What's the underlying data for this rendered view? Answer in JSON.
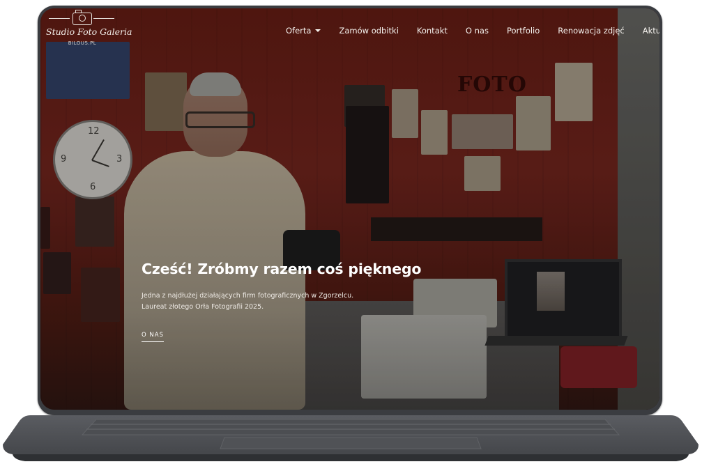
{
  "brand": {
    "name": "Studio Foto Galeria",
    "domain": "BILOUS.PL"
  },
  "nav": {
    "items": [
      {
        "label": "Oferta",
        "has_dropdown": true
      },
      {
        "label": "Zamów odbitki"
      },
      {
        "label": "Kontakt"
      },
      {
        "label": "O nas"
      },
      {
        "label": "Portfolio"
      },
      {
        "label": "Renowacja zdjęć"
      },
      {
        "label": "Aktualnoś"
      }
    ]
  },
  "hero": {
    "title": "Cześć! Zróbmy razem coś pięknego",
    "line1": "Jedna z najdłużej działających firm fotograficznych w Zgorzelcu.",
    "line2": "Laureat złotego Orła Fotografii 2025.",
    "cta": "O NAS"
  },
  "scene": {
    "wall_sign": "FOTO"
  },
  "colors": {
    "bezel": "#3a3c40",
    "wall": "#5a1a12",
    "text": "#ffffff"
  }
}
